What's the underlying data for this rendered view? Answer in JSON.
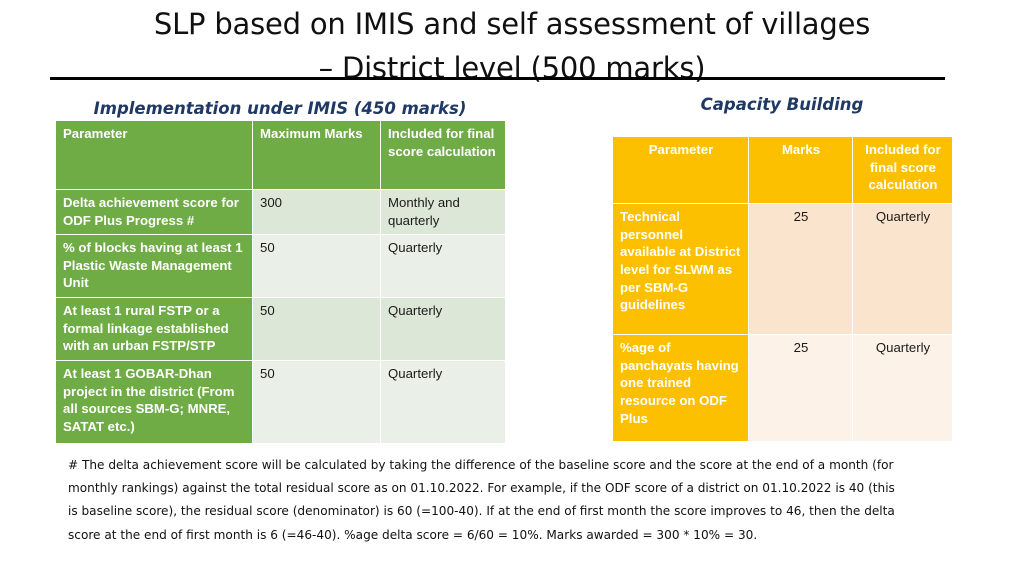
{
  "slide": {
    "title": "SLP based on IMIS  and self assessment of villages\n– District level (500 marks)"
  },
  "left_section": {
    "heading": "Implementation under IMIS (450 marks)",
    "table": {
      "columns": [
        "Parameter",
        "Maximum Marks",
        "Included for final score calculation"
      ],
      "rows": [
        {
          "parameter": "Delta achievement score for ODF Plus Progress #",
          "marks": "300",
          "included": "Monthly and quarterly"
        },
        {
          "parameter": "% of blocks having at least 1 Plastic Waste Management Unit",
          "marks": "50",
          "included": "Quarterly"
        },
        {
          "parameter": "At least 1 rural FSTP or a formal linkage established with an urban FSTP/STP",
          "marks": "50",
          "included": "Quarterly"
        },
        {
          "parameter": "At least 1 GOBAR-Dhan project in the district (From all sources SBM-G; MNRE, SATAT etc.)",
          "marks": "50",
          "included": "Quarterly"
        }
      ]
    }
  },
  "right_section": {
    "heading": "Capacity Building",
    "table": {
      "columns": [
        "Parameter",
        "Marks",
        "Included for final score calculation"
      ],
      "rows": [
        {
          "parameter": "Technical personnel available at District level for SLWM as per SBM-G guidelines",
          "marks": "25",
          "included": "Quarterly"
        },
        {
          "parameter": "%age of panchayats having one trained resource on ODF Plus",
          "marks": "25",
          "included": "Quarterly"
        }
      ]
    }
  },
  "footnote": {
    "text": "# The delta achievement score will be calculated by taking the difference of the baseline score and the score at the end of a month (for monthly rankings) against the total residual score as on 01.10.2022. For example, if the ODF score of a district on 01.10.2022 is 40 (this is baseline score), the residual score (denominator) is 60 (=100-40). If at the end of first month the score improves to 46, then the delta score at the end of first month is 6 (=46-40). %age delta score = 6/60 = 10%. Marks awarded = 300 * 10% = 30."
  },
  "colors": {
    "green_header": "#6FAC46",
    "green_shade_a": "#DDE7D7",
    "green_shade_b": "#EAF0E7",
    "amber_header": "#FCC000",
    "amber_shade_a": "#FBE4CD",
    "amber_shade_b": "#FDF2E8",
    "heading_navy": "#1F3864",
    "rule_black": "#000000"
  }
}
